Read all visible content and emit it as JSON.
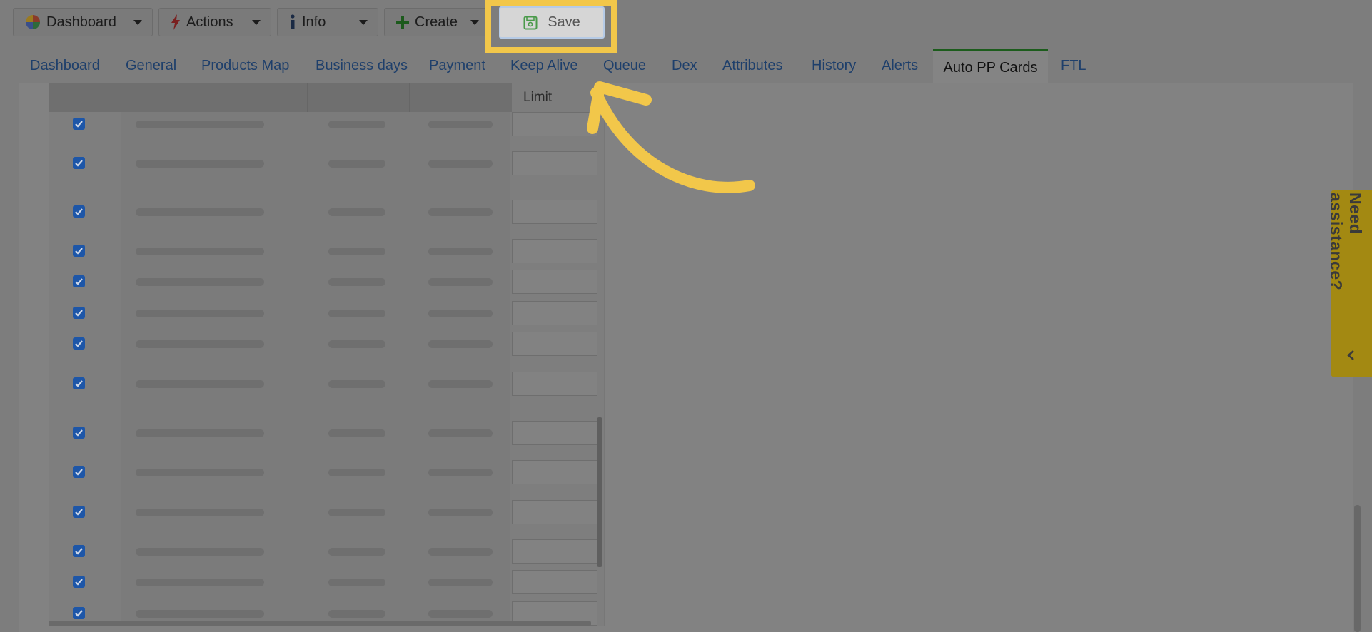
{
  "toolbar": {
    "dashboard_label": "Dashboard",
    "actions_label": "Actions",
    "info_label": "Info",
    "create_label": "Create",
    "save_label": "Save"
  },
  "tabs": [
    {
      "label": "Dashboard",
      "active": false
    },
    {
      "label": "General",
      "active": false
    },
    {
      "label": "Products Map",
      "active": false
    },
    {
      "label": "Business days",
      "active": false
    },
    {
      "label": "Payment",
      "active": false
    },
    {
      "label": "Keep Alive",
      "active": false
    },
    {
      "label": "Queue",
      "active": false
    },
    {
      "label": "Dex",
      "active": false
    },
    {
      "label": "Attributes",
      "active": false
    },
    {
      "label": "History",
      "active": false
    },
    {
      "label": "Alerts",
      "active": false
    },
    {
      "label": "Auto PP Cards",
      "active": true
    },
    {
      "label": "FTL",
      "active": false
    }
  ],
  "table": {
    "limit_header": "Limit",
    "rows": [
      {
        "checked": true
      },
      {
        "checked": true
      },
      {
        "checked": true
      },
      {
        "checked": true
      },
      {
        "checked": true
      },
      {
        "checked": true
      },
      {
        "checked": true
      },
      {
        "checked": true
      },
      {
        "checked": true
      },
      {
        "checked": true
      },
      {
        "checked": true
      },
      {
        "checked": true
      },
      {
        "checked": true
      },
      {
        "checked": true
      }
    ]
  },
  "assistance": {
    "label": "Need assistance?"
  },
  "colors": {
    "overlay": "#7d7d7d",
    "highlight": "#f2c74a",
    "active_tab_border": "#1c5c1c",
    "checkbox": "#1d56a8",
    "assistance_bg": "#a38912"
  }
}
